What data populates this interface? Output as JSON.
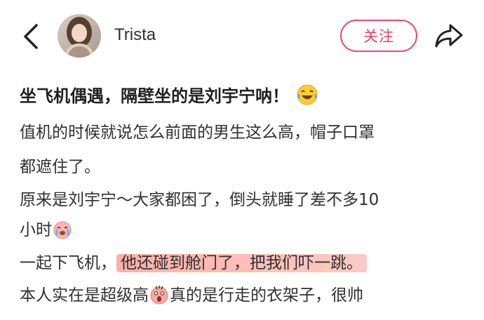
{
  "header": {
    "username": "Trista",
    "follow_label": "关注"
  },
  "post": {
    "title": "坐飞机偶遇，隔壁坐的是刘宇宁呐！",
    "title_emoji": "tears-of-joy-emoji",
    "lines": [
      "值机的时候就说怎么前面的男生这么高，帽子口罩",
      "都遮住了。",
      "原来是刘宇宁～大家都困了，倒头就睡了差不多10",
      "小时",
      "一起下飞机，",
      "他还碰到舱门了，把我们吓一跳。",
      "本人实在是超级高",
      "真的是行走的衣架子，很帅"
    ],
    "emojis": {
      "crying": "crying-face-emoji",
      "shocked": "shocked-face-emoji"
    },
    "highlight_color": "#f8978c"
  },
  "icons": {
    "back": "chevron-left-icon",
    "share": "share-arrow-icon"
  }
}
